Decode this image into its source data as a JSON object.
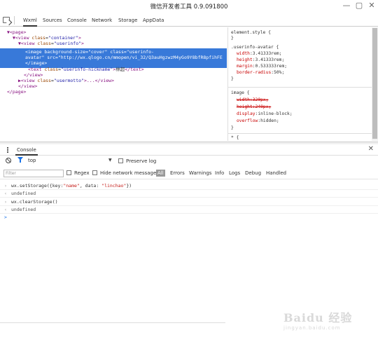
{
  "window": {
    "title": "微信开发者工具 0.9.091800",
    "controls": [
      "—",
      "▢",
      "✕"
    ]
  },
  "tabs": [
    "Wxml",
    "Sources",
    "Console",
    "Network",
    "Storage",
    "AppData"
  ],
  "elements": {
    "lines": {
      "l1_tag": "▼<page>",
      "l2_open": "▼<view ",
      "l2_attr": "class",
      "l2_val": "\"container\"",
      "l3_open": "▼<view ",
      "l3_attr": "class",
      "l3_val": "\"userinfo\"",
      "l4": "<image background-size=\"cover\" class=\"userinfo-",
      "l5": "avatar\" src=\"http://wx.qlogo.cn/mmopen/vi_32/Q3auHgzwzM4yGo9Y8bfR8pfihFE",
      "l6": "</image>",
      "l7_open": "<text ",
      "l7_attr": "class",
      "l7_val": "\"userinfo-nickname\"",
      "l7_text": "林超",
      "l7_close": "</text>",
      "l8": "</view>",
      "l9_open": "▶<view ",
      "l9_attr": "class",
      "l9_val": "\"usermotto\"",
      "l9_close": "...</view>",
      "l10": "</view>",
      "l11": "</page>"
    }
  },
  "styles": {
    "element_style": "element.style {",
    "close1": "}",
    "rule1_selector": ".userinfo-avatar {",
    "rule1_props": [
      {
        "name": "width",
        "value": "3.41333rem;"
      },
      {
        "name": "height",
        "value": "3.41333rem;"
      },
      {
        "name": "margin",
        "value": "0.533333rem;"
      },
      {
        "name": "border-radius",
        "value": "50%;"
      }
    ],
    "close2": "}",
    "rule2_selector": "image {",
    "rule2_props": [
      {
        "name": "width",
        "value": "320px;",
        "struck": true
      },
      {
        "name": "height",
        "value": "240px;",
        "struck": true
      },
      {
        "name": "display",
        "value": "inline-block;"
      },
      {
        "name": "overflow",
        "value": "hidden;"
      }
    ],
    "close3": "}",
    "more": "* {"
  },
  "drawer": {
    "tab": "Console",
    "close": "✕"
  },
  "console_toolbar": {
    "context": "top",
    "dropdown": "▼",
    "preserve_log": "Preserve log"
  },
  "filter_bar": {
    "placeholder": "Filter",
    "regex": "Regex",
    "hide_network": "Hide network messages",
    "levels": [
      "All",
      "Errors",
      "Warnings",
      "Info",
      "Logs",
      "Debug",
      "Handled"
    ]
  },
  "console": {
    "cmd1_pre": "wx.setStorage({key:",
    "cmd1_key": "\"name\"",
    "cmd1_mid": ", data: ",
    "cmd1_val": "\"linchao\"",
    "cmd1_post": "})",
    "res1": "undefined",
    "cmd2": "wx.clearStorage()",
    "res2": "undefined",
    "prompt": ">"
  },
  "watermark": {
    "big": "Baidu 经验",
    "small": "jingyan.baidu.com"
  }
}
